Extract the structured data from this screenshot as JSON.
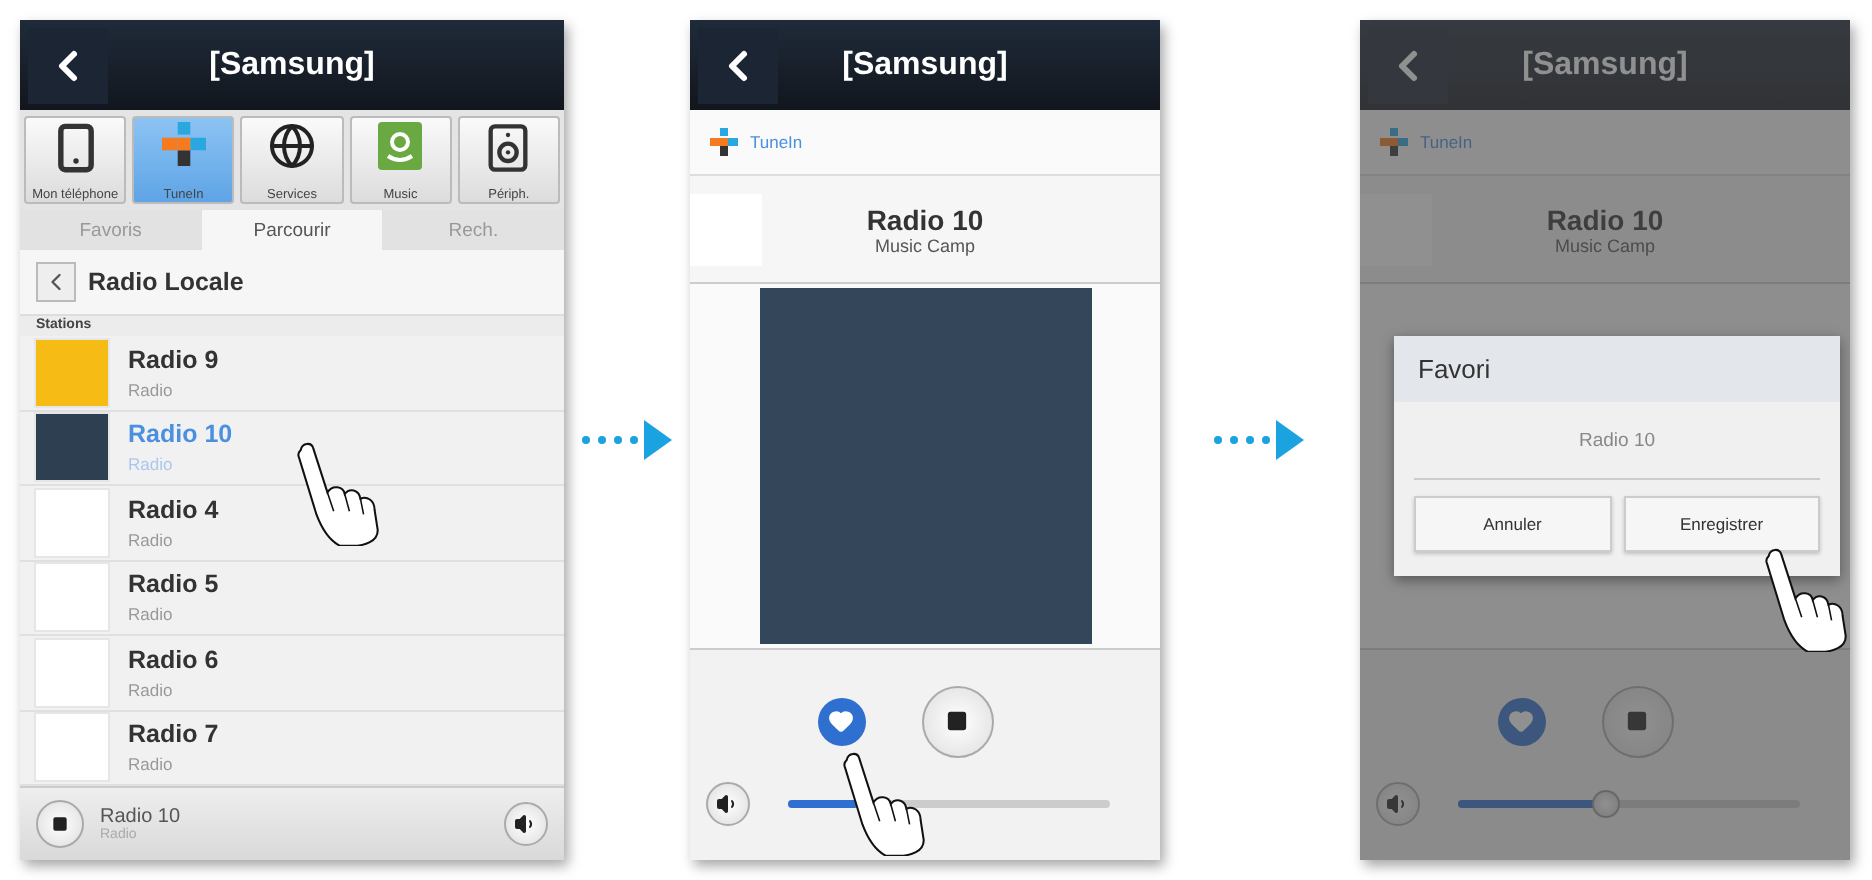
{
  "screens": [
    {
      "kind": "browse",
      "title": "[Samsung]",
      "sources": [
        {
          "label": "Mon téléphone",
          "kind": "phone",
          "selected": false
        },
        {
          "label": "TuneIn",
          "kind": "tunein",
          "selected": true
        },
        {
          "label": "Services",
          "kind": "globe",
          "selected": false
        },
        {
          "label": "Music",
          "kind": "store",
          "selected": false
        },
        {
          "label": "Périph.",
          "kind": "speaker",
          "selected": false
        }
      ],
      "tabs": [
        {
          "label": "Favoris",
          "selected": false
        },
        {
          "label": "Parcourir",
          "selected": true
        },
        {
          "label": "Rech.",
          "selected": false
        }
      ],
      "breadcrumb": "Radio Locale",
      "section": "Stations",
      "stations": [
        {
          "name": "Radio 9",
          "subtitle": "Radio",
          "color": "#f7bb16",
          "selected": false
        },
        {
          "name": "Radio 10",
          "subtitle": "Radio",
          "color": "#2e3f52",
          "selected": true
        },
        {
          "name": "Radio 4",
          "subtitle": "Radio",
          "color": "#ffffff",
          "selected": false
        },
        {
          "name": "Radio 5",
          "subtitle": "Radio",
          "color": "#ffffff",
          "selected": false
        },
        {
          "name": "Radio 6",
          "subtitle": "Radio",
          "color": "#ffffff",
          "selected": false
        },
        {
          "name": "Radio 7",
          "subtitle": "Radio",
          "color": "#ffffff",
          "selected": false
        }
      ],
      "now_playing": {
        "title": "Radio 10",
        "subtitle": "Radio"
      }
    },
    {
      "kind": "player",
      "title": "[Samsung]",
      "source": "TuneIn",
      "station": "Radio 10",
      "subtitle": "Music Camp",
      "artwork": true,
      "favorite": true,
      "volume": {
        "level": 0.22,
        "handle": false
      }
    },
    {
      "kind": "player",
      "title": "[Samsung]",
      "source": "TuneIn",
      "station": "Radio 10",
      "subtitle": "Music Camp",
      "artwork": false,
      "favorite": true,
      "volume": {
        "level": 0.43,
        "handle": true
      },
      "dialog": {
        "title": "Favori",
        "message": "Radio 10",
        "buttons": [
          "Annuler",
          "Enregistrer"
        ]
      }
    }
  ]
}
